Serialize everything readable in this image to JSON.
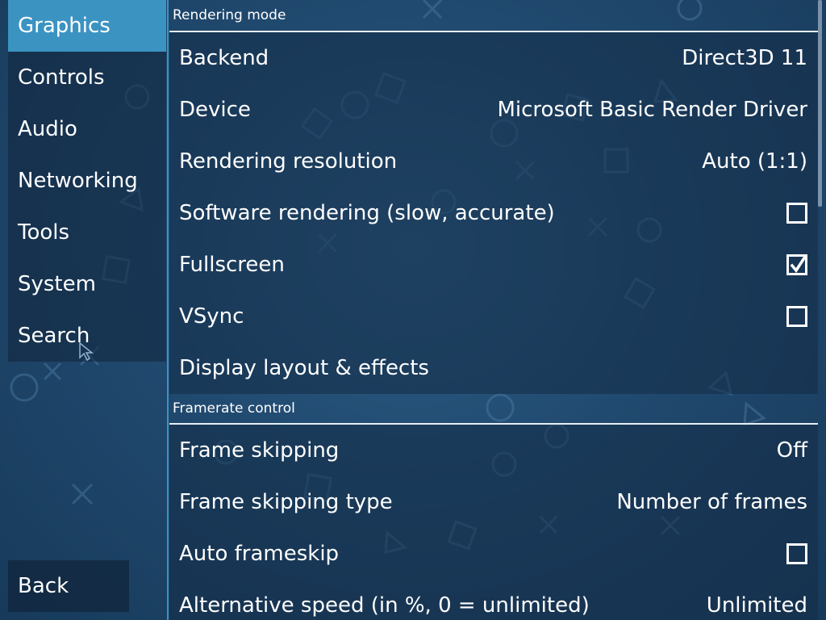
{
  "sidebar": {
    "items": [
      {
        "label": "Graphics",
        "active": true
      },
      {
        "label": "Controls"
      },
      {
        "label": "Audio"
      },
      {
        "label": "Networking"
      },
      {
        "label": "Tools"
      },
      {
        "label": "System"
      },
      {
        "label": "Search"
      }
    ],
    "back_label": "Back"
  },
  "sections": {
    "rendering": {
      "title": "Rendering mode",
      "rows": {
        "backend": {
          "label": "Backend",
          "value": "Direct3D 11"
        },
        "device": {
          "label": "Device",
          "value": "Microsoft Basic Render Driver"
        },
        "resolution": {
          "label": "Rendering resolution",
          "value": "Auto (1:1)"
        },
        "software": {
          "label": "Software rendering (slow, accurate)",
          "checked": false
        },
        "fullscreen": {
          "label": "Fullscreen",
          "checked": true
        },
        "vsync": {
          "label": "VSync",
          "checked": false
        },
        "display_layout": {
          "label": "Display layout & effects"
        }
      }
    },
    "framerate": {
      "title": "Framerate control",
      "rows": {
        "frame_skipping": {
          "label": "Frame skipping",
          "value": "Off"
        },
        "frame_skipping_type": {
          "label": "Frame skipping type",
          "value": "Number of frames"
        },
        "auto_frameskip": {
          "label": "Auto frameskip",
          "checked": false
        },
        "alt_speed": {
          "label": "Alternative speed (in %, 0 = unlimited)",
          "value": "Unlimited"
        }
      }
    }
  },
  "colors": {
    "accent": "#3b93c2",
    "background": "#214a70",
    "panel": "#142c46"
  },
  "icons": {
    "checkmark": "check-icon",
    "cursor": "mouse-cursor-icon",
    "background_pattern": "psp-symbols-pattern"
  }
}
